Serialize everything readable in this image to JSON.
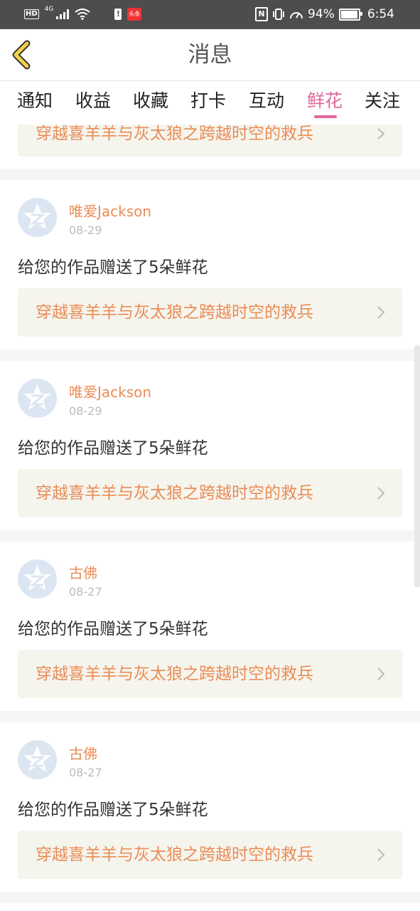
{
  "status_bar": {
    "hd": "HD",
    "network": "4G",
    "app_badge": "头条",
    "nfc": "N",
    "battery_percent": "94%",
    "time": "6:54"
  },
  "header": {
    "title": "消息"
  },
  "tabs": [
    {
      "label": "通知",
      "active": false
    },
    {
      "label": "收益",
      "active": false
    },
    {
      "label": "收藏",
      "active": false
    },
    {
      "label": "打卡",
      "active": false
    },
    {
      "label": "互动",
      "active": false
    },
    {
      "label": "鲜花",
      "active": true
    },
    {
      "label": "关注",
      "active": false
    }
  ],
  "partial_item": {
    "work_title": "穿越喜羊羊与灰太狼之跨越时空的救兵"
  },
  "messages": [
    {
      "user": "唯爱Jackson",
      "date": "08-29",
      "text": "给您的作品赠送了5朵鲜花",
      "work_title": "穿越喜羊羊与灰太狼之跨越时空的救兵"
    },
    {
      "user": "唯爱Jackson",
      "date": "08-29",
      "text": "给您的作品赠送了5朵鲜花",
      "work_title": "穿越喜羊羊与灰太狼之跨越时空的救兵"
    },
    {
      "user": "古佛",
      "date": "08-27",
      "text": "给您的作品赠送了5朵鲜花",
      "work_title": "穿越喜羊羊与灰太狼之跨越时空的救兵"
    },
    {
      "user": "古佛",
      "date": "08-27",
      "text": "给您的作品赠送了5朵鲜花",
      "work_title": "穿越喜羊羊与灰太狼之跨越时空的救兵"
    }
  ],
  "colors": {
    "accent": "#e0669f",
    "username": "#ea8c56",
    "back_icon": "#f2d24a"
  },
  "icons": {
    "back": "chevron-left-icon",
    "avatar": "default-avatar-icon",
    "link": "chevron-right-icon"
  }
}
